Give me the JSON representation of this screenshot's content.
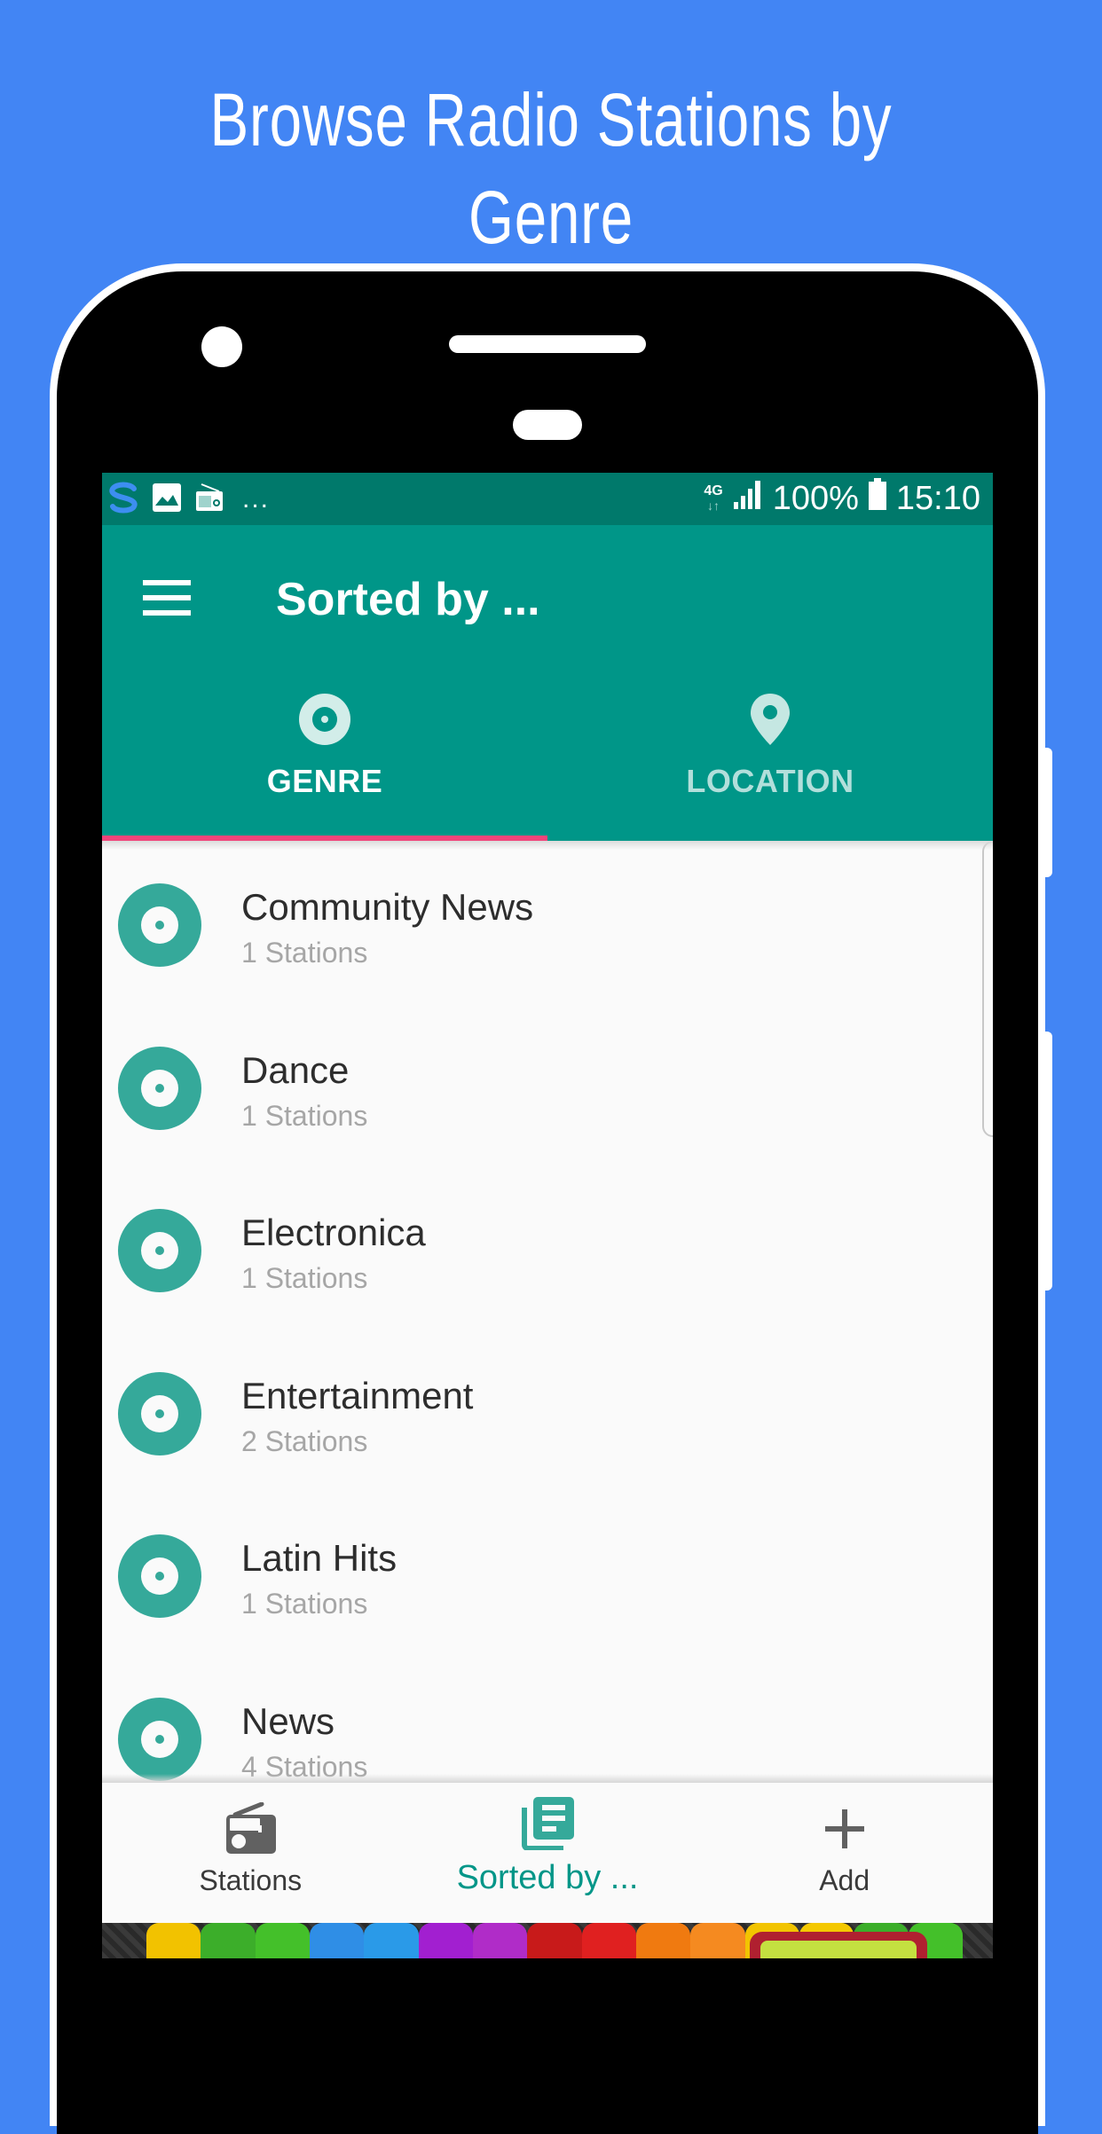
{
  "headline": "Browse Radio Stations by Genre",
  "status_bar": {
    "left_icons": [
      "shield-app-icon",
      "image-icon",
      "radio-icon"
    ],
    "overflow": "...",
    "network": "4G",
    "battery": "100%",
    "time": "15:10"
  },
  "toolbar": {
    "menu_icon": "hamburger-menu-icon",
    "title": "Sorted by ..."
  },
  "tabs": [
    {
      "label": "GENRE",
      "icon": "disc-icon",
      "active": true
    },
    {
      "label": "LOCATION",
      "icon": "location-pin-icon",
      "active": false
    }
  ],
  "genres": [
    {
      "name": "Community News",
      "count": "1 Stations"
    },
    {
      "name": "Dance",
      "count": "1 Stations"
    },
    {
      "name": "Electronica",
      "count": "1 Stations"
    },
    {
      "name": "Entertainment",
      "count": "2 Stations"
    },
    {
      "name": "Latin Hits",
      "count": "1 Stations"
    },
    {
      "name": "News",
      "count": "4 Stations"
    }
  ],
  "bottom_nav": [
    {
      "label": "Stations",
      "icon": "radio-icon",
      "active": false
    },
    {
      "label": "Sorted by ...",
      "icon": "library-books-icon",
      "active": true
    },
    {
      "label": "Add",
      "icon": "plus-icon",
      "active": false
    }
  ],
  "colors": {
    "background": "#4285F4",
    "primary": "#009688",
    "primary_dark": "#00796B",
    "accent": "#F0447A",
    "disc": "#35A99A",
    "inactive_nav": "#616161"
  }
}
